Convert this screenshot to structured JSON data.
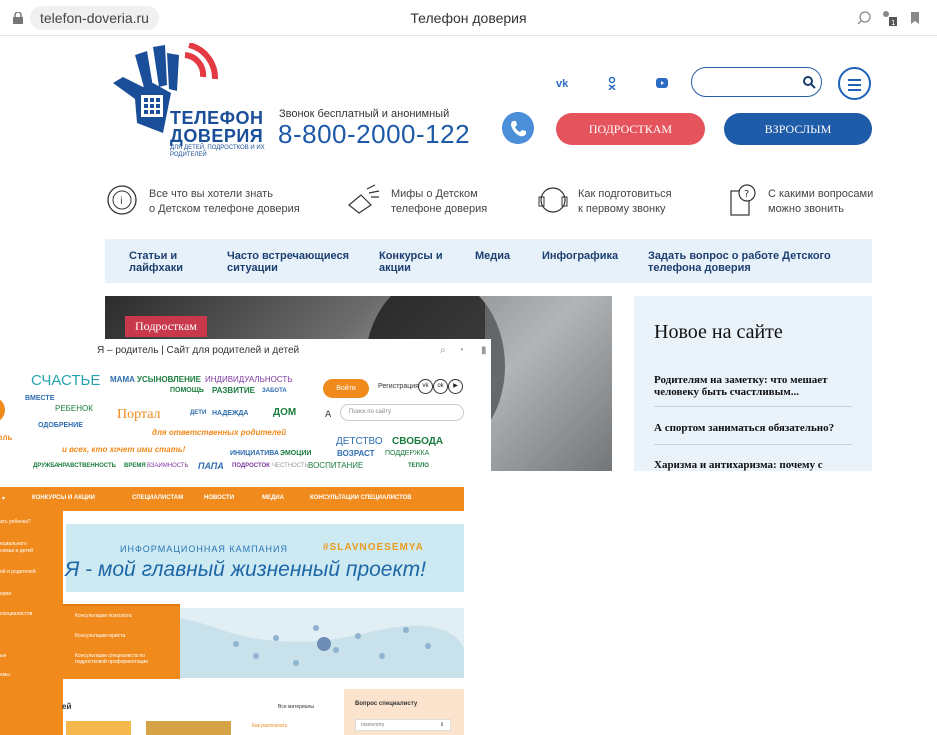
{
  "browser": {
    "url": "telefon-doveria.ru",
    "title": "Телефон доверия"
  },
  "header": {
    "logo_title_1": "ТЕЛЕФОН",
    "logo_title_2": "ДОВЕРИЯ",
    "logo_subtitle": "ДЛЯ ДЕТЕЙ, ПОДРОСТКОВ И ИХ РОДИТЕЛЕЙ",
    "call_note": "Звонок бесплатный и анонимный",
    "phone": "8-800-2000-122",
    "social": [
      "vk",
      "ok",
      "youtube"
    ],
    "search_placeholder": "",
    "btn_teens": "ПОДРОСТКАМ",
    "btn_adults": "ВЗРОСЛЫМ"
  },
  "features": [
    {
      "line1": "Все что вы хотели знать",
      "line2": "о Детском телефоне доверия"
    },
    {
      "line1": "Мифы о Детском",
      "line2": "телефоне доверия"
    },
    {
      "line1": "Как подготовиться",
      "line2": "к первому звонку"
    },
    {
      "line1": "С какими вопросами",
      "line2": "можно звонить"
    }
  ],
  "nav": [
    {
      "line1": "Статьи и",
      "line2": "лайфхаки"
    },
    {
      "line1": "Часто встречающиеся",
      "line2": "ситуации"
    },
    {
      "line1": "Конкурсы и",
      "line2": "акции"
    },
    {
      "line1": "Медиа",
      "line2": ""
    },
    {
      "line1": "Инфографика",
      "line2": ""
    },
    {
      "line1": "Задать вопрос о работе Детского",
      "line2": "телефона доверия"
    }
  ],
  "hero": {
    "tag": "Подросткам"
  },
  "news": {
    "title": "Новое на сайте",
    "items": [
      {
        "line1": "Родителям на заметку: что мешает",
        "line2": "человеку быть счастливым..."
      },
      {
        "line1": "А спортом заниматься обязательно?",
        "line2": ""
      },
      {
        "line1": "Харизма и антихаризма: почему с",
        "line2": ""
      }
    ]
  },
  "overlay": {
    "title": "Я – родитель | Сайт для родителей и детей",
    "cloud": {
      "w1": "СЧАСТЬЕ",
      "w2": "МАМА",
      "w3": "УСЫНОВЛЕНИЕ",
      "w4": "ИНДИВИДУАЛЬНОСТЬ",
      "w5": "ВМЕСТЕ",
      "w6": "РЕБЕНОК",
      "w7": "ПОМОЩЬ",
      "w8": "РАЗВИТИЕ",
      "w9": "ЗАБОТА",
      "w10": "Портал",
      "w11": "ДЕТИ",
      "w12": "НАДЕЖДА",
      "w13": "ДОМ",
      "w14": "ОДОБРЕНИЕ",
      "w15": "для ответственных родителей",
      "w16": "и всех, кто хочет ими стать!",
      "w17": "ДЕТСТВО",
      "w18": "СВОБОДА",
      "w19": "ВОЗРАСТ",
      "w20": "ПОДДЕРЖКА",
      "w21": "ИНИЦИАТИВА",
      "w22": "ЭМОЦИИ",
      "w23": "ДРУЖБА",
      "w24": "НРАВСТВЕННОСТЬ",
      "w25": "ВРЕМЯ",
      "w26": "ВЗАИМНОСТЬ",
      "w27": "ПАПА",
      "w28": "ПОДРОСТОК",
      "w29": "ЧЕСТНОСТЬ",
      "w30": "ВОСПИТАНИЕ",
      "w31": "ТЕПЛО",
      "w32": "ель"
    },
    "login": "Войти",
    "register": "Регистрация",
    "search_placeholder": "Поиск по сайту",
    "nav": [
      "КОНКУРСЫ И АКЦИИ",
      "СПЕЦИАЛИСТАМ",
      "НОВОСТИ",
      "МЕДИА",
      "КОНСУЛЬТАЦИИ СПЕЦИАЛИСТОВ"
    ],
    "banner": {
      "sub": "ИНФОРМАЦИОННАЯ КАМПАНИЯ",
      "tag": "#SLAVNOESEMYA",
      "main": "Я - мой главный жизненный проект!"
    },
    "sidebar": [
      "ать ребенка?",
      "ециального",
      "семьи и детей",
      "ей и родителей",
      "ерии",
      "специалистов",
      "ые",
      "емы"
    ],
    "submenu": [
      "Консультации психолога",
      "Консультации юриста",
      "Консультации специалиста по",
      "подростковой профориентации"
    ],
    "map_word": "ЕЙ",
    "bottom_label": "ей",
    "all_materials": "Все материалы",
    "article_teaser": "Как распознать",
    "q_title": "Вопрос специалисту",
    "q_select": "психологу"
  }
}
